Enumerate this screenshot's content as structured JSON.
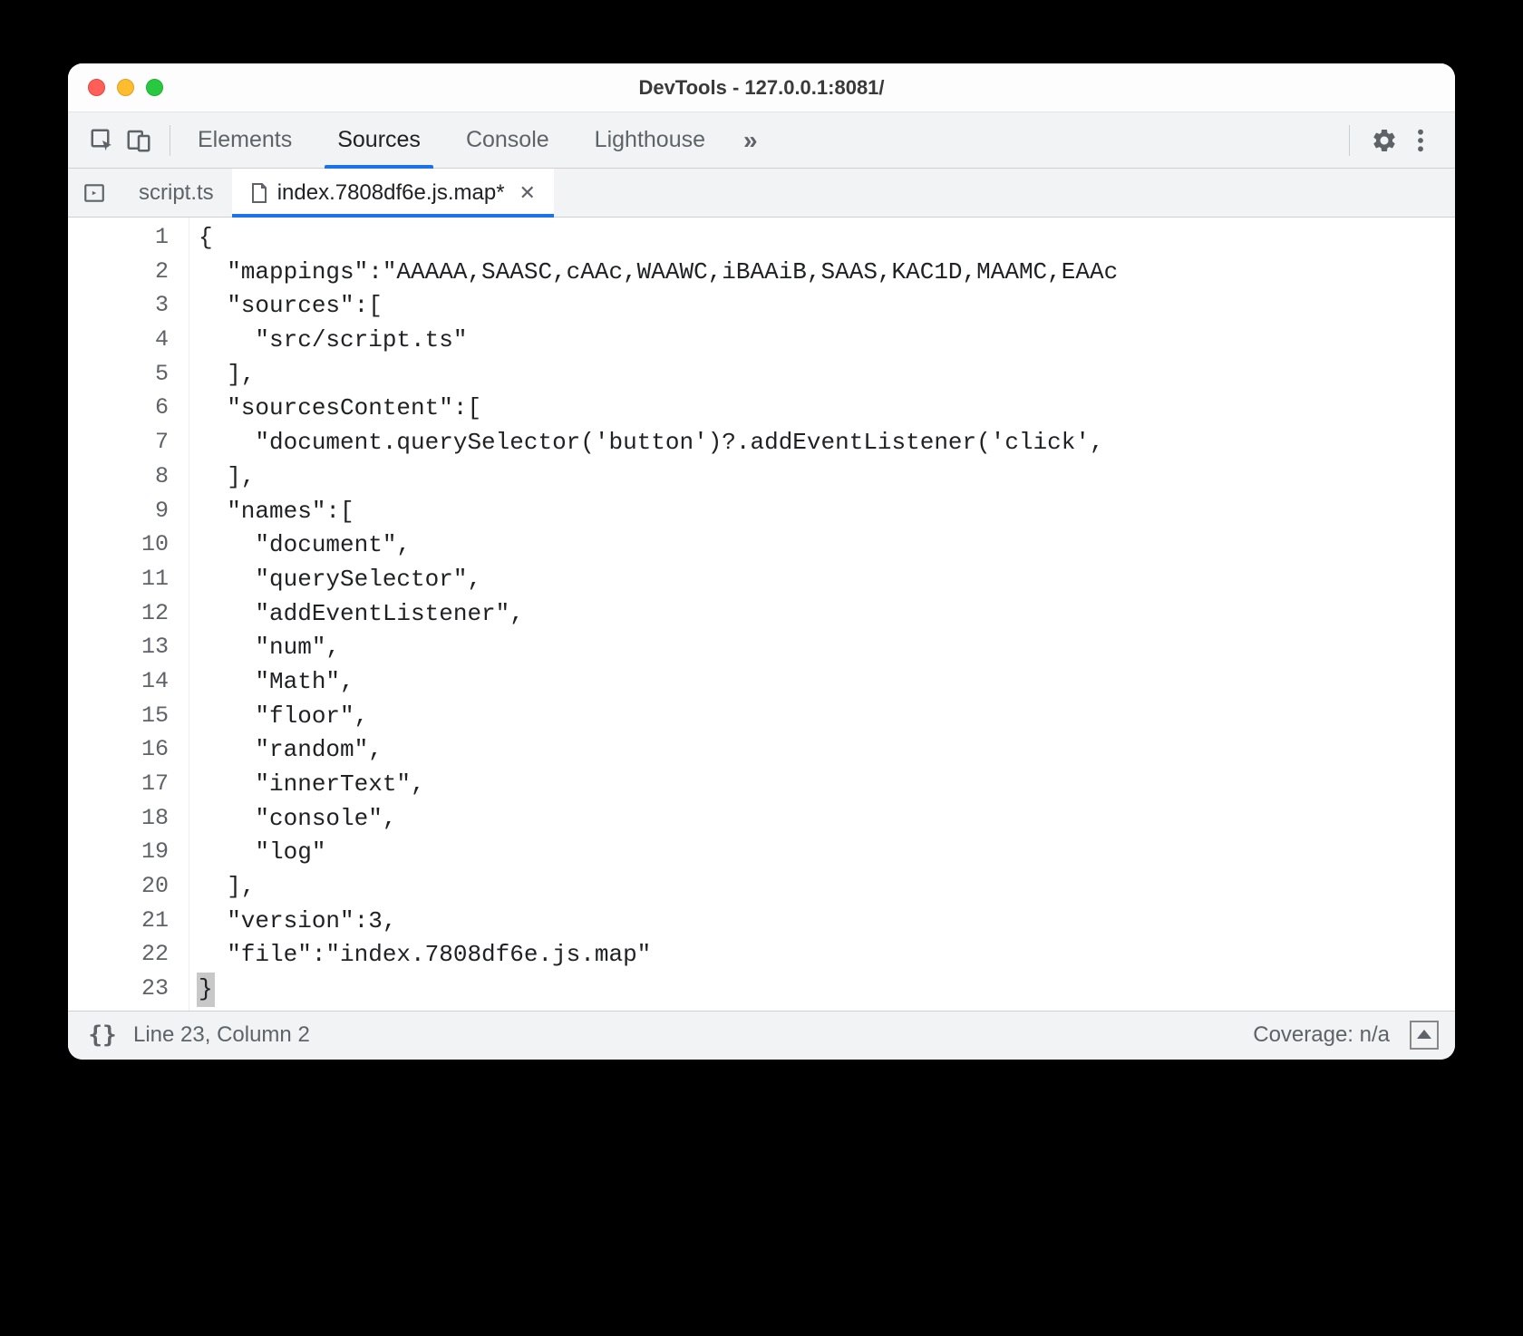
{
  "window": {
    "title": "DevTools - 127.0.0.1:8081/"
  },
  "toolbar": {
    "panels": [
      {
        "label": "Elements",
        "active": false
      },
      {
        "label": "Sources",
        "active": true
      },
      {
        "label": "Console",
        "active": false
      },
      {
        "label": "Lighthouse",
        "active": false
      }
    ],
    "overflow_label": "»"
  },
  "file_tabs": [
    {
      "label": "script.ts",
      "active": false,
      "dirty": false,
      "closable": false
    },
    {
      "label": "index.7808df6e.js.map*",
      "active": true,
      "dirty": true,
      "closable": true
    }
  ],
  "editor": {
    "lines": [
      "{",
      "  \"mappings\":\"AAAAA,SAASC,cAAc,WAAWC,iBAAiB,SAAS,KAC1D,MAAMC,EAAc",
      "  \"sources\":[",
      "    \"src/script.ts\"",
      "  ],",
      "  \"sourcesContent\":[",
      "    \"document.querySelector('button')?.addEventListener('click',",
      "  ],",
      "  \"names\":[",
      "    \"document\",",
      "    \"querySelector\",",
      "    \"addEventListener\",",
      "    \"num\",",
      "    \"Math\",",
      "    \"floor\",",
      "    \"random\",",
      "    \"innerText\",",
      "    \"console\",",
      "    \"log\"",
      "  ],",
      "  \"version\":3,",
      "  \"file\":\"index.7808df6e.js.map\"",
      "}"
    ],
    "line_count": 23,
    "cursor_line": 23,
    "cursor_col": 2
  },
  "status": {
    "pretty_print_label": "{}",
    "position_label": "Line 23, Column 2",
    "coverage_label": "Coverage: n/a"
  }
}
